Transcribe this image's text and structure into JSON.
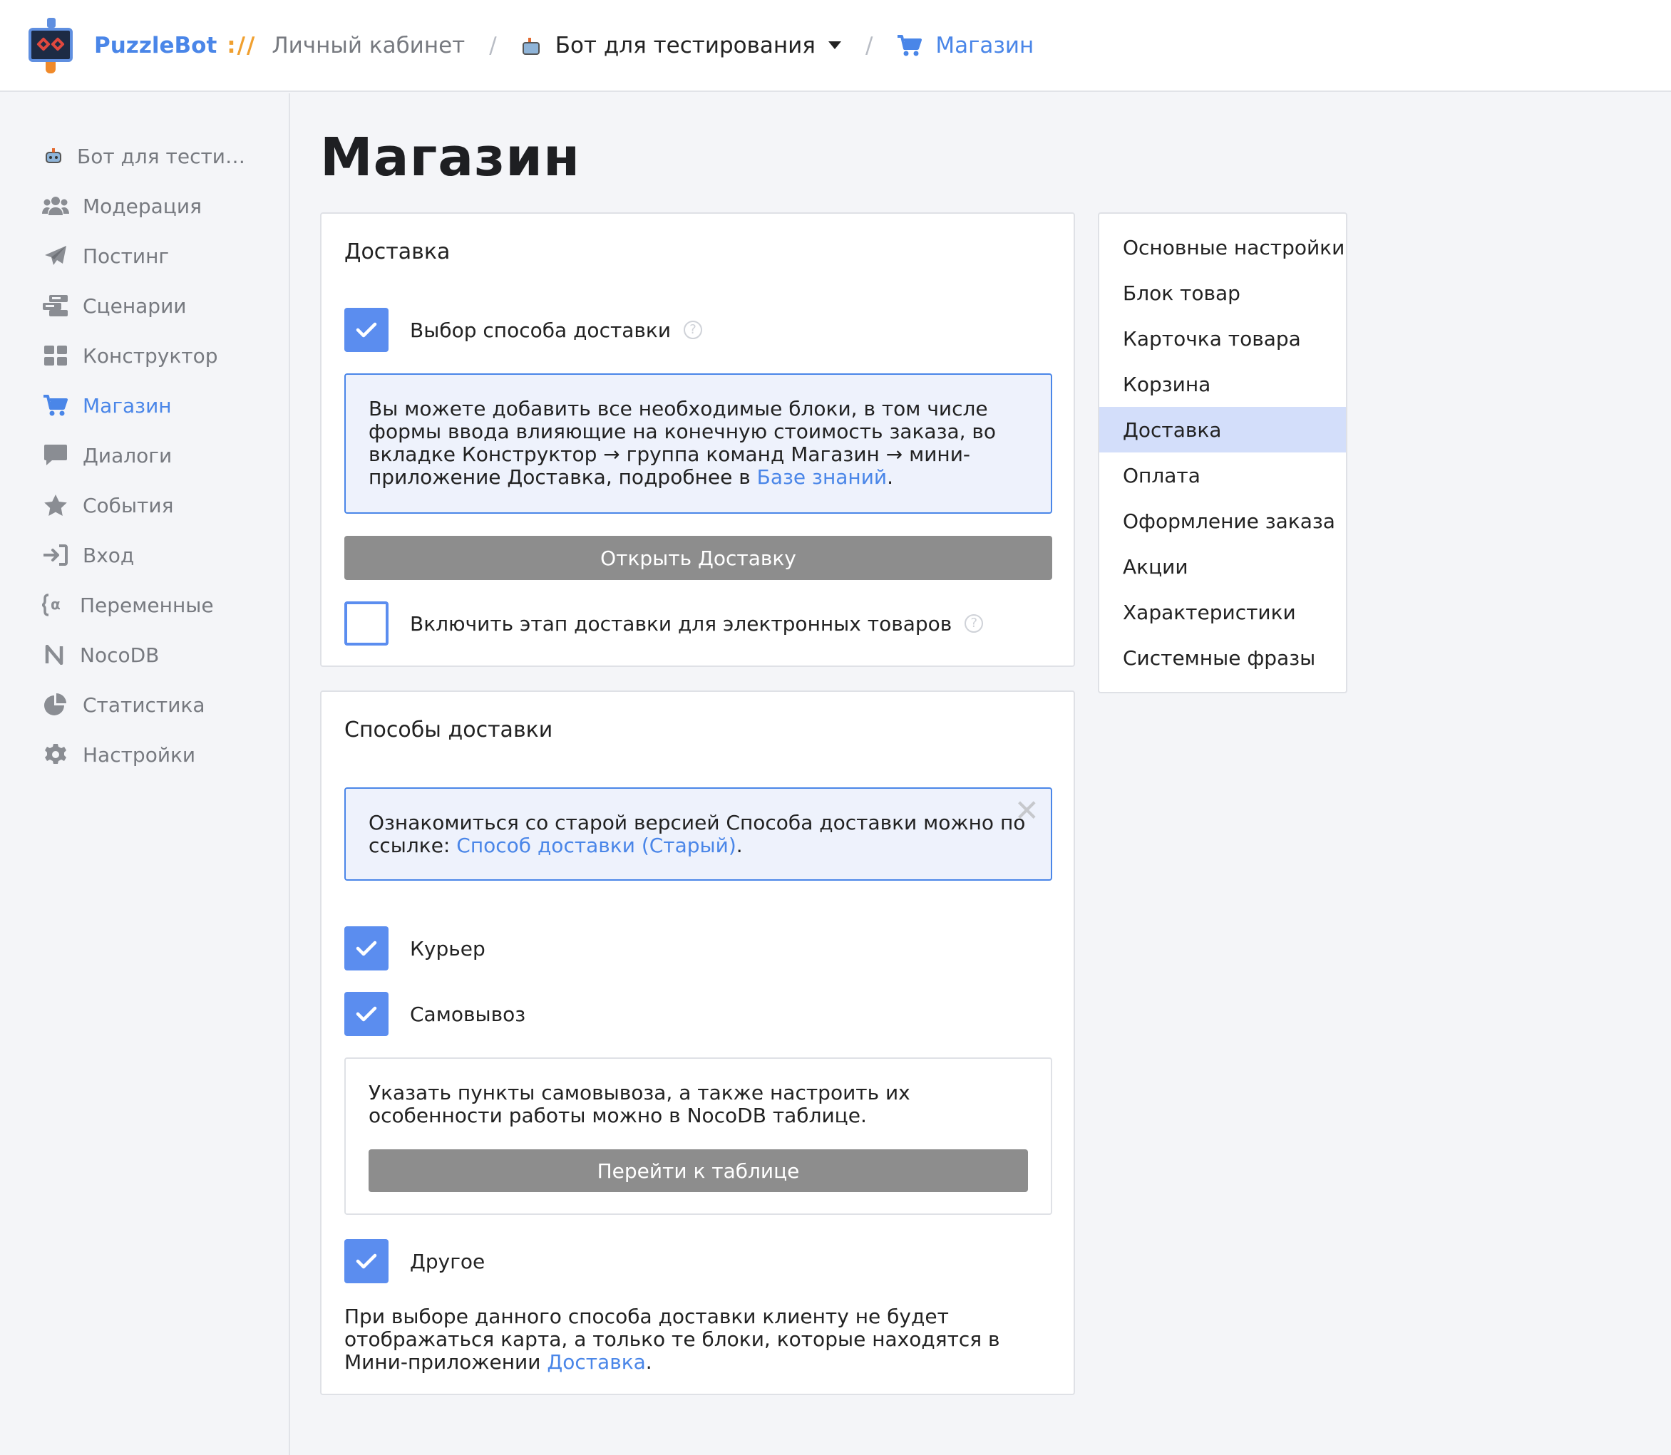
{
  "topbar": {
    "brand": "PuzzleBot",
    "brand_sep": "://",
    "cabinet": "Личный кабинет",
    "bot_name": "Бот для тестирования",
    "section": "Магазин"
  },
  "sidebar": {
    "items": [
      {
        "label": "Бот для тести…",
        "icon": "bot-icon"
      },
      {
        "label": "Модерация",
        "icon": "users-icon"
      },
      {
        "label": "Постинг",
        "icon": "paper-plane-icon"
      },
      {
        "label": "Сценарии",
        "icon": "scenario-icon"
      },
      {
        "label": "Конструктор",
        "icon": "grid-icon"
      },
      {
        "label": "Магазин",
        "icon": "cart-icon"
      },
      {
        "label": "Диалоги",
        "icon": "chat-icon"
      },
      {
        "label": "События",
        "icon": "star-icon"
      },
      {
        "label": "Вход",
        "icon": "sign-in-icon"
      },
      {
        "label": "Переменные",
        "icon": "variable-icon"
      },
      {
        "label": "NocoDB",
        "icon": "nocodb-icon"
      },
      {
        "label": "Статистика",
        "icon": "pie-chart-icon"
      },
      {
        "label": "Настройки",
        "icon": "gear-icon"
      }
    ],
    "active_index": 5
  },
  "page_title": "Магазин",
  "delivery_card": {
    "title": "Доставка",
    "choose_method": {
      "label": "Выбор способа доставки",
      "checked": true,
      "help": "?"
    },
    "info_text": "Вы можете добавить все необходимые блоки, в том числе формы ввода влияющие на конечную стоимость заказа, во вкладке Конструктор → группа команд Магазин → мини-приложение Доставка, подробнее в ",
    "info_link": "Базе знаний",
    "info_end": ".",
    "open_button": "Открыть Доставку",
    "digital_step": {
      "label": "Включить этап доставки для электронных товаров",
      "checked": false,
      "help": "?"
    }
  },
  "methods_card": {
    "title": "Способы доставки",
    "notice_text": "Ознакомиться со старой версией Способа доставки можно по ссылке: ",
    "notice_link": "Способ доставки (Старый)",
    "notice_end": ".",
    "close": "✕",
    "courier": {
      "label": "Курьер",
      "checked": true
    },
    "pickup": {
      "label": "Самовывоз",
      "checked": true
    },
    "pickup_text": "Указать пункты самовывоза, а также настроить их особенности работы можно в NocoDB таблице.",
    "table_button": "Перейти к таблице",
    "other": {
      "label": "Другое",
      "checked": true
    },
    "other_text": "При выборе данного способа доставки клиенту не будет отображаться карта, а только те блоки, которые находятся в Мини-приложении ",
    "other_link": "Доставка",
    "other_end": "."
  },
  "right_menu": {
    "items": [
      "Основные настройки",
      "Блок товар",
      "Карточка товара",
      "Корзина",
      "Доставка",
      "Оплата",
      "Оформление заказа",
      "Акции",
      "Характеристики",
      "Системные фразы"
    ],
    "active_index": 4
  },
  "colors": {
    "accent": "#4a86e8",
    "checkbox": "#5b8def",
    "button_gray": "#8d8d8d",
    "info_bg": "#eef2fc",
    "menu_active_bg": "#d3defa"
  }
}
